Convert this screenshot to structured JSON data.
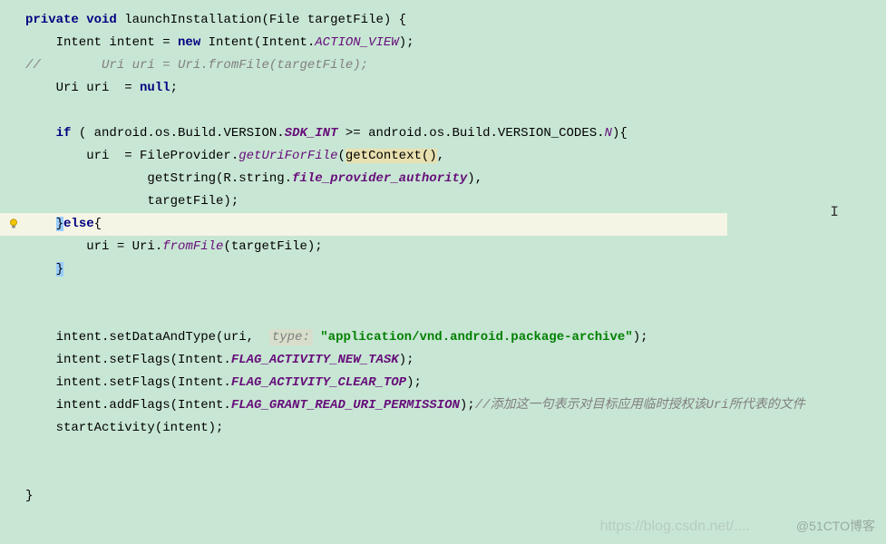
{
  "code": {
    "l1_kw1": "private",
    "l1_kw2": "void",
    "l1_rest": " launchInstallation(File targetFile) {",
    "l2_a": "    Intent intent = ",
    "l2_kw": "new",
    "l2_b": " Intent(Intent.",
    "l2_s": "ACTION_VIEW",
    "l2_c": ");",
    "l3_comment": "//        Uri uri = Uri.fromFile(targetFile);",
    "l4": "    Uri uri  = ",
    "l4_kw": "null",
    "l4_b": ";",
    "l6_a": "    ",
    "l6_kw": "if",
    "l6_b": " ( android.os.Build.VERSION.",
    "l6_s": "SDK_INT",
    "l6_c": " >= android.os.Build.VERSION_CODES.",
    "l6_s2": "N",
    "l6_d": "){",
    "l7_a": "        uri  = FileProvider.",
    "l7_m": "getUriForFile",
    "l7_b": "(",
    "l7_hl": "getContext()",
    "l7_c": ",",
    "l8_a": "                getString(R.string.",
    "l8_s": "file_provider_authority",
    "l8_b": "),",
    "l9": "                targetFile);",
    "l10_a": "    ",
    "l10_b": "}",
    "l10_kw": "else",
    "l10_c": "{",
    "l11_a": "        uri = Uri.",
    "l11_m": "fromFile",
    "l11_b": "(targetFile);",
    "l12_a": "    ",
    "l12_b": "}",
    "l15_a": "    intent.setDataAndType(uri,  ",
    "l15_hint": "type:",
    "l15_b": " ",
    "l15_str": "\"application/vnd.android.package-archive\"",
    "l15_c": ");",
    "l16_a": "    intent.setFlags(Intent.",
    "l16_s": "FLAG_ACTIVITY_NEW_TASK",
    "l16_b": ");",
    "l17_a": "    intent.setFlags(Intent.",
    "l17_s": "FLAG_ACTIVITY_CLEAR_TOP",
    "l17_b": ");",
    "l18_a": "    intent.addFlags(Intent.",
    "l18_s": "FLAG_GRANT_READ_URI_PERMISSION",
    "l18_b": ");",
    "l18_c": "//添加这一句表示对目标应用临时授权该Uri所代表的文件",
    "l19": "    startActivity(intent);",
    "l_end": "}"
  },
  "watermark1": "https://blog.csdn.net/....",
  "watermark2": "@51CTO博客"
}
